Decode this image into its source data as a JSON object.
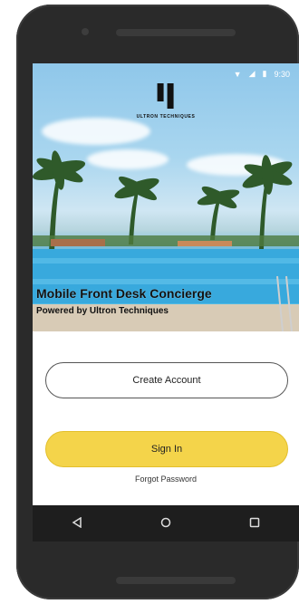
{
  "status_bar": {
    "time": "9:30"
  },
  "logo": {
    "brand": "ULTRON TECHNIQUES"
  },
  "hero": {
    "title": "Mobile Front Desk Concierge",
    "subtitle": "Powered by Ultron Techniques"
  },
  "actions": {
    "create_account": "Create Account",
    "sign_in": "Sign In",
    "forgot_password": "Forgot Password"
  },
  "nav": {
    "back_icon": "back-triangle-icon",
    "home_icon": "home-circle-icon",
    "recents_icon": "recents-square-icon"
  },
  "colors": {
    "accent": "#f4d44a"
  }
}
